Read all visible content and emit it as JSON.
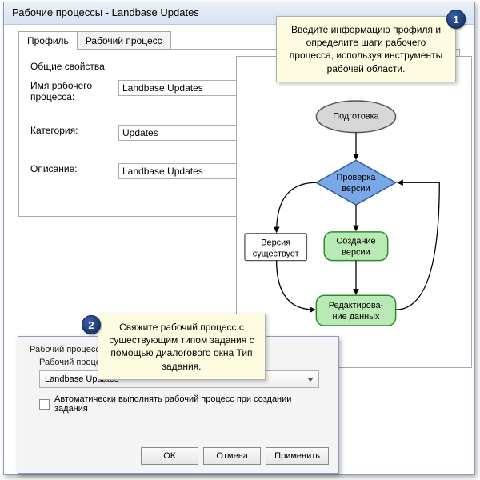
{
  "window": {
    "title": "Рабочие процессы - Landbase Updates"
  },
  "tabs": {
    "profile": "Профиль",
    "workflow": "Рабочий процесс"
  },
  "profile_pane": {
    "group": "Общие свойства",
    "name_label": "Имя рабочего процесса:",
    "name_value": "Landbase Updates",
    "category_label": "Категория:",
    "category_value": "Updates",
    "description_label": "Описание:",
    "description_value": "Landbase Updates"
  },
  "flow": {
    "nodes": {
      "prep": "Подготовка",
      "check_l1": "Проверка",
      "check_l2": "версии",
      "exists_l1": "Версия",
      "exists_l2": "существует",
      "create_l1": "Создание",
      "create_l2": "версии",
      "edit_l1": "Редактирова-",
      "edit_l2": "ние данных"
    }
  },
  "callouts": {
    "c1": "Введите информацию профиля и определите шаги рабочего процесса, используя инструменты рабочей области.",
    "c2": "Свяжите рабочий процесс с существующим типом задания с помощью диалогового окна Тип задания.",
    "badge1": "1",
    "badge2": "2"
  },
  "lower": {
    "section_label": "Рабочий процесс",
    "combo_label": "Рабочий процесс",
    "combo_value": "Landbase Updates",
    "auto_chk": "Автоматически выполнять рабочий процесс при создании задания",
    "ok": "OK",
    "cancel": "Отмена",
    "apply": "Применить"
  }
}
